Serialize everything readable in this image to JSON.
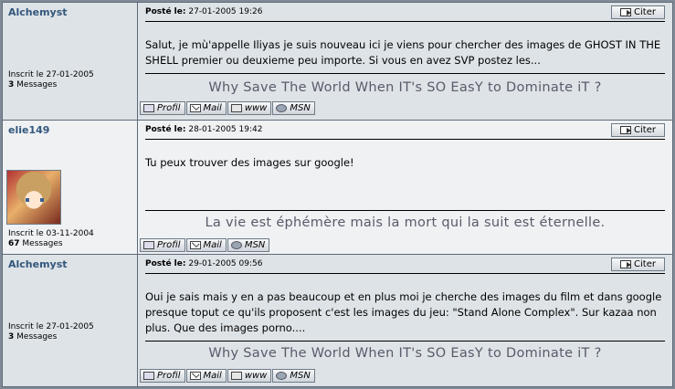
{
  "posts": [
    {
      "author": "Alchemyst",
      "joined": "Inscrit le 27-01-2005",
      "messages_count": "3",
      "messages_label": "Messages",
      "posted_label": "Posté le:",
      "date": "27-01-2005 19:26",
      "quote_label": "Citer",
      "message": "Salut, je mù'appelle Iliyas je suis nouveau ici je viens pour chercher des images de GHOST IN THE SHELL premier ou deuxieme peu importe. Si vous en avez SVP postez les...",
      "signature": "Why Save The World When IT's SO EasY to Dominate iT ?",
      "buttons": [
        "Profil",
        "Mail",
        "www",
        "MSN"
      ]
    },
    {
      "author": "elie149",
      "joined": "Inscrit le 03-11-2004",
      "messages_count": "67",
      "messages_label": "Messages",
      "posted_label": "Posté le:",
      "date": "28-01-2005 19:42",
      "quote_label": "Citer",
      "message": "Tu peux trouver des images sur google!",
      "signature": "La vie est éphémère mais la mort qui la suit est éternelle.",
      "buttons": [
        "Profil",
        "Mail",
        "MSN"
      ]
    },
    {
      "author": "Alchemyst",
      "joined": "Inscrit le 27-01-2005",
      "messages_count": "3",
      "messages_label": "Messages",
      "posted_label": "Posté le:",
      "date": "29-01-2005 09:56",
      "quote_label": "Citer",
      "message": "Oui je sais mais y en a pas beaucoup et en plus moi je cherche des images du film et dans google presque toput ce qu'ils proposent c'est les images du jeu: \"Stand Alone Complex\". Sur kazaa non plus. Que des images porno....",
      "signature": "Why Save The World When IT's SO EasY to Dominate iT ?",
      "buttons": [
        "Profil",
        "Mail",
        "www",
        "MSN"
      ]
    }
  ]
}
